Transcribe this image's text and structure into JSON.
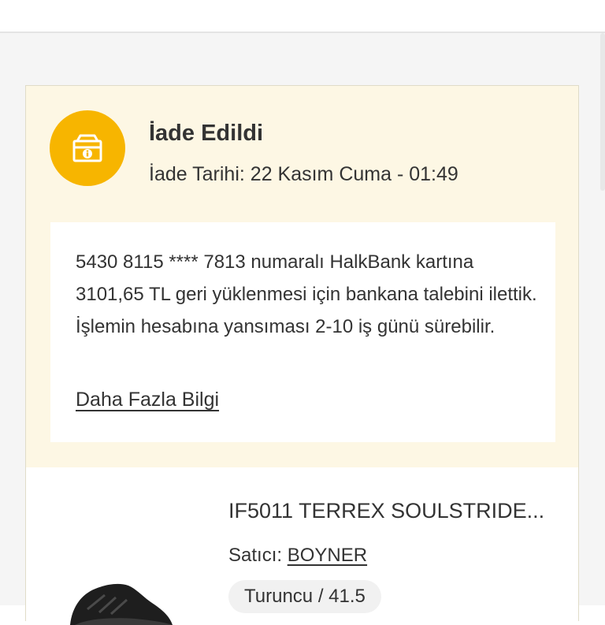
{
  "status": {
    "title": "İade Edildi",
    "date": "İade Tarihi: 22 Kasım Cuma - 01:49",
    "icon": "refund-box-icon",
    "icon_color": "#f7b500",
    "background_color": "#fdf7e4"
  },
  "info": {
    "text": "5430 8115 **** 7813  numaralı HalkBank kartına 3101,65 TL geri yüklenmesi için bankana talebini ilettik. İşlemin hesabına yansıması 2-10 iş günü sürebilir.",
    "more_link": "Daha Fazla Bilgi"
  },
  "product": {
    "title": "IF5011 TERREX SOULSTRIDE...",
    "seller_label": "Satıcı:",
    "seller_name": "BOYNER",
    "variant": "Turuncu / 41.5",
    "image": "sneaker-thumbnail"
  }
}
